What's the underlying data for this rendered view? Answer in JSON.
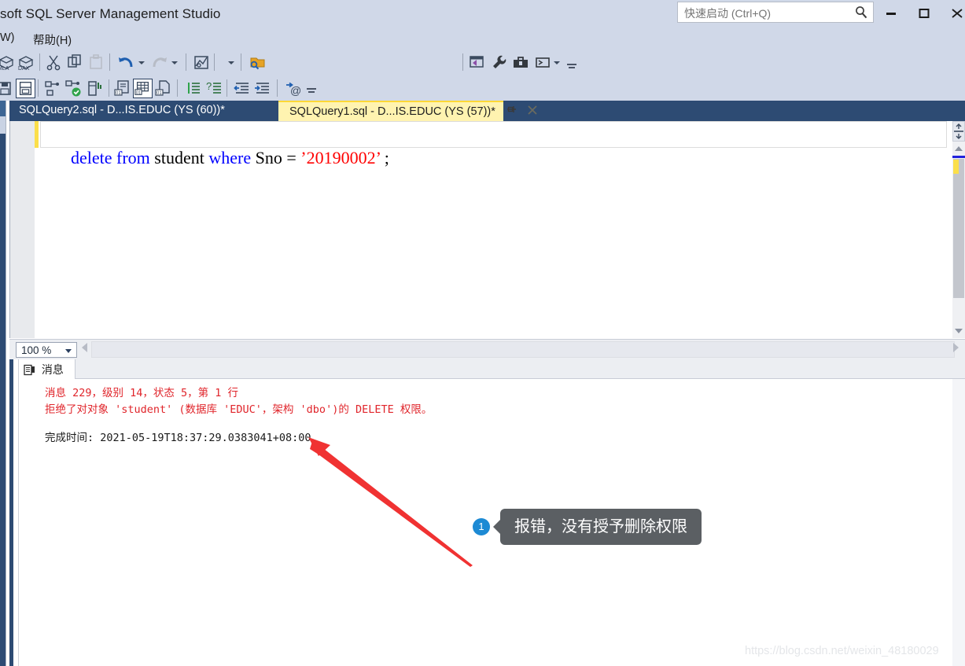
{
  "window": {
    "title": "soft SQL Server Management Studio",
    "minimize_label": "minimize",
    "maximize_label": "maximize",
    "close_label": "close"
  },
  "quick_launch": {
    "placeholder": "快速启动 (Ctrl+Q)",
    "value": "",
    "icon": "search-icon"
  },
  "menu": {
    "items": [
      {
        "label": "W)"
      },
      {
        "label": "帮助(H)"
      }
    ]
  },
  "toolbar": {
    "combo_value": "",
    "icons_row1": [
      "mla-icon",
      "dax-icon",
      "cut-icon",
      "copy-icon",
      "paste-icon",
      "undo-icon",
      "undo-dropdown-icon",
      "redo-icon",
      "redo-dropdown-icon",
      "new-query-icon",
      "toolbar-dropdown-icon",
      "open-file-icon"
    ],
    "icons_row1_right": [
      "visual-studio-icon",
      "wrench-icon",
      "toolbox-icon",
      "command-prompt-icon",
      "command-dropdown-icon",
      "overflow-icon"
    ],
    "icons_row2": [
      "save-icon",
      "save-all-icon",
      "parse-icon",
      "execute-check-icon",
      "database-report-icon",
      "results-to-text-icon",
      "results-to-grid-icon",
      "results-to-file-icon",
      "comment-icon",
      "uncomment-icon",
      "decrease-indent-icon",
      "increase-indent-icon",
      "specify-values-icon",
      "overflow-icon"
    ]
  },
  "tabs": [
    {
      "label": "SQLQuery2.sql - D...IS.EDUC (YS (60))*",
      "active": false
    },
    {
      "label": "SQLQuery1.sql - D...IS.EDUC (YS (57))*",
      "active": true
    }
  ],
  "tab_actions": {
    "pin_label": "pin-icon",
    "close_label": "close-icon"
  },
  "editor": {
    "code_tokens": [
      {
        "text": "delete",
        "kind": "keyword"
      },
      {
        "text": " ",
        "kind": "plain"
      },
      {
        "text": "from",
        "kind": "keyword"
      },
      {
        "text": " student ",
        "kind": "plain"
      },
      {
        "text": "where",
        "kind": "keyword"
      },
      {
        "text": " Sno = ",
        "kind": "plain"
      },
      {
        "text": "’20190002’",
        "kind": "string"
      },
      {
        "text": " ;",
        "kind": "plain"
      }
    ],
    "code_plain": "delete from student where Sno = ’20190002’ ;",
    "zoom_level": "100 %"
  },
  "results": {
    "tab_label": "消息",
    "tab_icon": "messages-icon",
    "lines": [
      {
        "text": "消息 229，级别 14，状态 5，第 1 行",
        "color": "red"
      },
      {
        "text": "拒绝了对对象 'student' (数据库 'EDUC'，架构 'dbo')的 DELETE 权限。",
        "color": "red"
      },
      {
        "text": "",
        "color": "black"
      },
      {
        "text": "完成时间: 2021-05-19T18:37:29.0383041+08:00",
        "color": "black"
      }
    ]
  },
  "annotation": {
    "badge": "1",
    "text": "报错，没有授予删除权限",
    "arrow_color": "#f03232",
    "badge_color": "#1d8ad4",
    "callout_bg": "#5b5f63"
  },
  "watermark": {
    "text": "https://blog.csdn.net/weixin_48180029"
  },
  "colors": {
    "chrome": "#d0d8e8",
    "tab_active": "#fff3b0",
    "tab_strip": "#2d4b73",
    "keyword": "#0000ff",
    "string": "#ff0000",
    "error": "#e0252b"
  }
}
